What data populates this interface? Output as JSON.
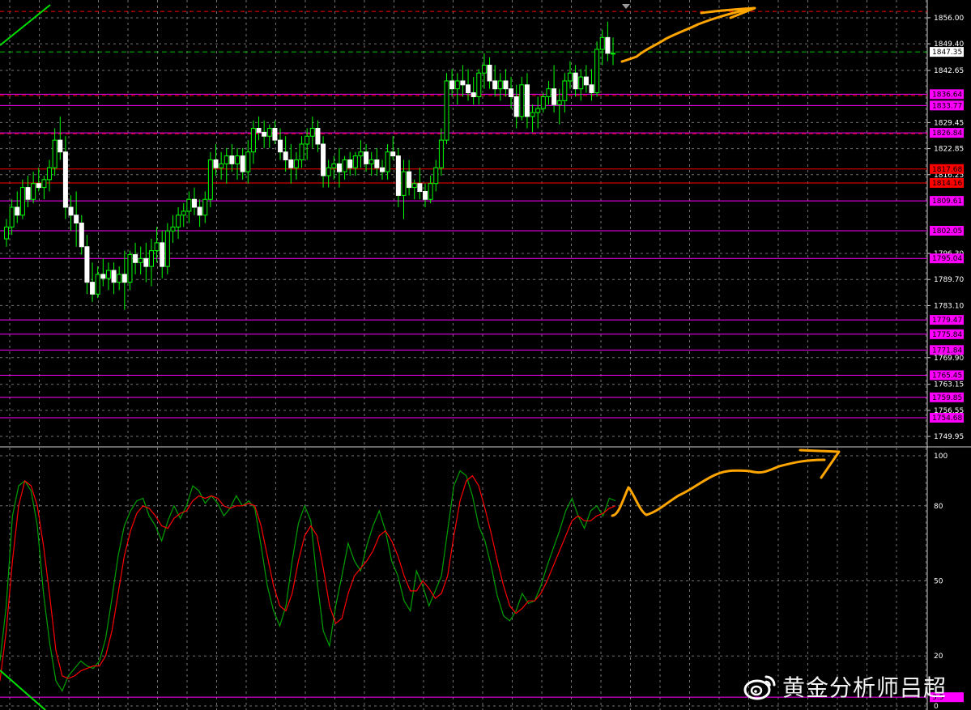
{
  "chart_data": [
    {
      "type": "candlestick",
      "title": "",
      "ylim": [
        1747.5,
        1860.5
      ],
      "price_axis_labels": [
        "1856.00",
        "1849.40",
        "1842.65",
        "1829.45",
        "1822.85",
        "1816.25",
        "1796.30",
        "1789.70",
        "1783.10",
        "1769.90",
        "1763.15",
        "1756.55",
        "1749.95"
      ],
      "current_price": {
        "value": "1847.35",
        "color": "#ffffff"
      },
      "levels": [
        {
          "value": 1836.64,
          "label": "1836.64",
          "color": "#ff00ff"
        },
        {
          "value": 1833.77,
          "label": "1833.77",
          "color": "#ff00ff"
        },
        {
          "value": 1826.84,
          "label": "1826.84",
          "color": "#ff00ff"
        },
        {
          "value": 1817.68,
          "label": "1817.68",
          "color": "#ff0000"
        },
        {
          "value": 1814.16,
          "label": "1814.16",
          "color": "#ff0000"
        },
        {
          "value": 1809.61,
          "label": "1809.61",
          "color": "#ff00ff"
        },
        {
          "value": 1802.05,
          "label": "1802.05",
          "color": "#ff00ff"
        },
        {
          "value": 1795.04,
          "label": "1795.04",
          "color": "#ff00ff"
        },
        {
          "value": 1779.47,
          "label": "1779.47",
          "color": "#ff00ff"
        },
        {
          "value": 1775.84,
          "label": "1775.84",
          "color": "#ff00ff"
        },
        {
          "value": 1771.84,
          "label": "1771.84",
          "color": "#ff00ff"
        },
        {
          "value": 1765.45,
          "label": "1765.45",
          "color": "#ff00ff"
        },
        {
          "value": 1759.85,
          "label": "1759.85",
          "color": "#ff00ff"
        },
        {
          "value": 1754.68,
          "label": "1754.68",
          "color": "#ff00ff"
        }
      ],
      "dashed_levels": [
        1857.6,
        1836.3,
        1826.6
      ],
      "colors": {
        "bull_body": "#000000",
        "bull_outline": "#00ff00",
        "bear_body": "#ffffff",
        "wick": "#00ff00",
        "grid": "#9a9a9a"
      },
      "candles": [
        [
          1800,
          1805,
          1798,
          1803
        ],
        [
          1803,
          1810,
          1801,
          1808
        ],
        [
          1808,
          1812,
          1804,
          1806
        ],
        [
          1806,
          1815,
          1805,
          1813
        ],
        [
          1813,
          1816,
          1808,
          1810
        ],
        [
          1810,
          1817,
          1809,
          1814
        ],
        [
          1814,
          1818,
          1812,
          1813
        ],
        [
          1813,
          1816,
          1810,
          1815
        ],
        [
          1815,
          1820,
          1812,
          1818
        ],
        [
          1818,
          1828,
          1816,
          1825
        ],
        [
          1825,
          1831,
          1820,
          1822
        ],
        [
          1822,
          1826,
          1805,
          1808
        ],
        [
          1808,
          1811,
          1802,
          1806
        ],
        [
          1806,
          1812,
          1798,
          1804
        ],
        [
          1804,
          1806,
          1796,
          1798
        ],
        [
          1798,
          1801,
          1786,
          1789
        ],
        [
          1789,
          1794,
          1784,
          1786
        ],
        [
          1786,
          1793,
          1785,
          1791
        ],
        [
          1791,
          1795,
          1788,
          1790
        ],
        [
          1790,
          1794,
          1787,
          1792
        ],
        [
          1792,
          1794,
          1786,
          1789
        ],
        [
          1789,
          1793,
          1787,
          1791
        ],
        [
          1791,
          1797,
          1782,
          1789
        ],
        [
          1789,
          1797,
          1787,
          1796
        ],
        [
          1796,
          1799,
          1791,
          1794
        ],
        [
          1794,
          1798,
          1791,
          1795
        ],
        [
          1795,
          1799,
          1789,
          1793
        ],
        [
          1793,
          1800,
          1788,
          1797
        ],
        [
          1797,
          1803,
          1794,
          1799
        ],
        [
          1799,
          1802,
          1790,
          1793
        ],
        [
          1793,
          1804,
          1791,
          1802
        ],
        [
          1802,
          1806,
          1799,
          1803
        ],
        [
          1803,
          1808,
          1800,
          1806
        ],
        [
          1806,
          1809,
          1803,
          1807
        ],
        [
          1807,
          1812,
          1804,
          1810
        ],
        [
          1810,
          1813,
          1806,
          1808
        ],
        [
          1808,
          1810,
          1803,
          1806
        ],
        [
          1806,
          1812,
          1804,
          1810
        ],
        [
          1810,
          1822,
          1808,
          1820
        ],
        [
          1820,
          1824,
          1816,
          1818
        ],
        [
          1818,
          1822,
          1815,
          1819
        ],
        [
          1819,
          1823,
          1814,
          1821
        ],
        [
          1821,
          1824,
          1817,
          1819
        ],
        [
          1819,
          1823,
          1815,
          1821
        ],
        [
          1821,
          1823,
          1815,
          1817
        ],
        [
          1817,
          1825,
          1814,
          1822
        ],
        [
          1822,
          1830,
          1819,
          1828
        ],
        [
          1828,
          1831,
          1825,
          1827
        ],
        [
          1827,
          1830,
          1823,
          1826
        ],
        [
          1826,
          1829,
          1823,
          1828
        ],
        [
          1828,
          1830,
          1824,
          1825
        ],
        [
          1825,
          1828,
          1820,
          1822
        ],
        [
          1822,
          1826,
          1817,
          1820
        ],
        [
          1820,
          1824,
          1814,
          1818
        ],
        [
          1818,
          1822,
          1815,
          1820
        ],
        [
          1820,
          1826,
          1818,
          1824
        ],
        [
          1824,
          1828,
          1820,
          1826
        ],
        [
          1826,
          1831,
          1823,
          1828
        ],
        [
          1828,
          1830,
          1822,
          1824
        ],
        [
          1824,
          1826,
          1813,
          1816
        ],
        [
          1816,
          1820,
          1813,
          1818
        ],
        [
          1818,
          1821,
          1815,
          1819
        ],
        [
          1819,
          1823,
          1813,
          1817
        ],
        [
          1817,
          1821,
          1815,
          1820
        ],
        [
          1820,
          1822,
          1816,
          1818
        ],
        [
          1818,
          1822,
          1816,
          1821
        ],
        [
          1821,
          1825,
          1818,
          1822
        ],
        [
          1822,
          1824,
          1817,
          1819
        ],
        [
          1819,
          1822,
          1816,
          1820
        ],
        [
          1820,
          1823,
          1816,
          1818
        ],
        [
          1818,
          1820,
          1815,
          1817
        ],
        [
          1817,
          1824,
          1815,
          1822
        ],
        [
          1822,
          1826,
          1820,
          1821
        ],
        [
          1821,
          1823,
          1808,
          1811
        ],
        [
          1811,
          1820,
          1805,
          1817
        ],
        [
          1817,
          1820,
          1811,
          1813
        ],
        [
          1813,
          1815,
          1810,
          1814
        ],
        [
          1814,
          1818,
          1810,
          1812
        ],
        [
          1812,
          1814,
          1808,
          1810
        ],
        [
          1810,
          1816,
          1809,
          1814
        ],
        [
          1814,
          1820,
          1812,
          1818
        ],
        [
          1818,
          1828,
          1816,
          1825
        ],
        [
          1825,
          1842,
          1824,
          1840
        ],
        [
          1840,
          1843,
          1836,
          1838
        ],
        [
          1838,
          1842,
          1834,
          1840
        ],
        [
          1840,
          1844,
          1836,
          1839
        ],
        [
          1839,
          1843,
          1835,
          1837
        ],
        [
          1837,
          1841,
          1834,
          1836
        ],
        [
          1836,
          1843,
          1834,
          1842
        ],
        [
          1842,
          1847,
          1838,
          1844
        ],
        [
          1844,
          1846,
          1838,
          1840
        ],
        [
          1840,
          1844,
          1836,
          1838
        ],
        [
          1838,
          1842,
          1835,
          1840
        ],
        [
          1840,
          1843,
          1836,
          1838
        ],
        [
          1838,
          1841,
          1833,
          1836
        ],
        [
          1836,
          1839,
          1828,
          1831
        ],
        [
          1831,
          1841,
          1830,
          1839
        ],
        [
          1839,
          1842,
          1828,
          1831
        ],
        [
          1831,
          1834,
          1827,
          1832
        ],
        [
          1832,
          1836,
          1828,
          1833
        ],
        [
          1833,
          1837,
          1832,
          1836
        ],
        [
          1836,
          1840,
          1834,
          1838
        ],
        [
          1838,
          1844,
          1832,
          1834
        ],
        [
          1834,
          1838,
          1829,
          1835
        ],
        [
          1835,
          1842,
          1832,
          1840
        ],
        [
          1840,
          1845,
          1838,
          1842
        ],
        [
          1842,
          1844,
          1836,
          1838
        ],
        [
          1838,
          1843,
          1835,
          1841
        ],
        [
          1841,
          1844,
          1837,
          1839
        ],
        [
          1839,
          1843,
          1835,
          1837
        ],
        [
          1837,
          1850,
          1836,
          1848
        ],
        [
          1848,
          1853,
          1844,
          1851
        ],
        [
          1851,
          1855,
          1845,
          1847
        ],
        [
          1847,
          1851,
          1844,
          1847
        ]
      ]
    },
    {
      "type": "line",
      "title": "",
      "ylim": [
        0,
        100
      ],
      "axis_labels": [
        "100",
        "80",
        "50",
        "20",
        "0"
      ],
      "level": {
        "value": 3.5,
        "label": "3.5",
        "color": "#ff00ff"
      },
      "series": [
        {
          "color": "#00a000",
          "values": [
            18,
            40,
            76,
            88,
            90,
            86,
            72,
            45,
            25,
            10,
            6,
            12,
            15,
            18,
            16,
            15,
            18,
            27,
            43,
            60,
            72,
            78,
            82,
            83,
            76,
            72,
            66,
            74,
            80,
            75,
            80,
            88,
            86,
            81,
            84,
            81,
            76,
            79,
            84,
            80,
            82,
            79,
            64,
            48,
            38,
            32,
            40,
            58,
            73,
            80,
            74,
            50,
            30,
            24,
            40,
            52,
            65,
            58,
            54,
            64,
            72,
            78,
            70,
            58,
            52,
            42,
            38,
            54,
            48,
            40,
            46,
            52,
            70,
            88,
            94,
            92,
            84,
            72,
            66,
            56,
            44,
            36,
            34,
            38,
            45,
            41,
            42,
            48,
            56,
            63,
            70,
            78,
            83,
            76,
            71,
            78,
            80,
            76,
            83,
            82
          ]
        },
        {
          "color": "#ff0000",
          "values": [
            10,
            30,
            58,
            80,
            90,
            88,
            80,
            64,
            44,
            22,
            12,
            11,
            12,
            14,
            15,
            16,
            16,
            20,
            30,
            45,
            60,
            70,
            77,
            80,
            79,
            76,
            72,
            71,
            75,
            77,
            78,
            82,
            84,
            83,
            84,
            83,
            80,
            79,
            80,
            80,
            81,
            80,
            72,
            60,
            48,
            40,
            38,
            45,
            58,
            68,
            72,
            68,
            55,
            40,
            33,
            35,
            45,
            52,
            55,
            58,
            62,
            68,
            70,
            66,
            60,
            52,
            46,
            46,
            50,
            47,
            43,
            45,
            52,
            68,
            82,
            90,
            92,
            88,
            79,
            69,
            58,
            48,
            40,
            37,
            39,
            42,
            42,
            45,
            50,
            56,
            62,
            68,
            74,
            76,
            74,
            74,
            76,
            77,
            79,
            80
          ]
        }
      ]
    }
  ],
  "annotations": {
    "color": "#ffa500"
  },
  "watermark": {
    "text": "黄金分析师吕超"
  }
}
